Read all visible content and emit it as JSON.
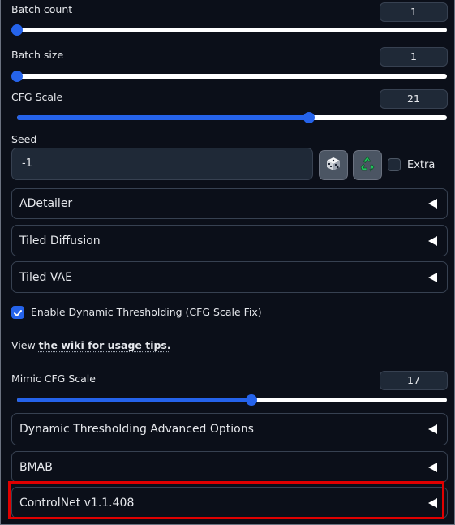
{
  "batch_count": {
    "label": "Batch count",
    "value": "1",
    "fraction": 0.0
  },
  "batch_size": {
    "label": "Batch size",
    "value": "1",
    "fraction": 0.0
  },
  "cfg_scale": {
    "label": "CFG Scale",
    "value": "21",
    "fraction": 0.68
  },
  "seed": {
    "label": "Seed",
    "value": "-1",
    "random_icon": "dice-icon",
    "reuse_icon": "recycle-icon",
    "extra_label": "Extra",
    "extra_checked": false
  },
  "accordions": {
    "adetailer": "ADetailer",
    "tiled_diffusion": "Tiled Diffusion",
    "tiled_vae": "Tiled VAE",
    "dt_advanced": "Dynamic Thresholding Advanced Options",
    "bmab": "BMAB",
    "controlnet": "ControlNet v1.1.408"
  },
  "dynamic_thresholding": {
    "enable_label": "Enable Dynamic Thresholding (CFG Scale Fix)",
    "enabled": true,
    "view_prefix": "View ",
    "wiki_link": "the wiki for usage tips.",
    "mimic_label": "Mimic CFG Scale",
    "mimic_value": "17",
    "mimic_fraction": 0.545
  },
  "colors": {
    "accent": "#2563eb",
    "background": "#0b0f19",
    "highlight": "#e00000"
  }
}
